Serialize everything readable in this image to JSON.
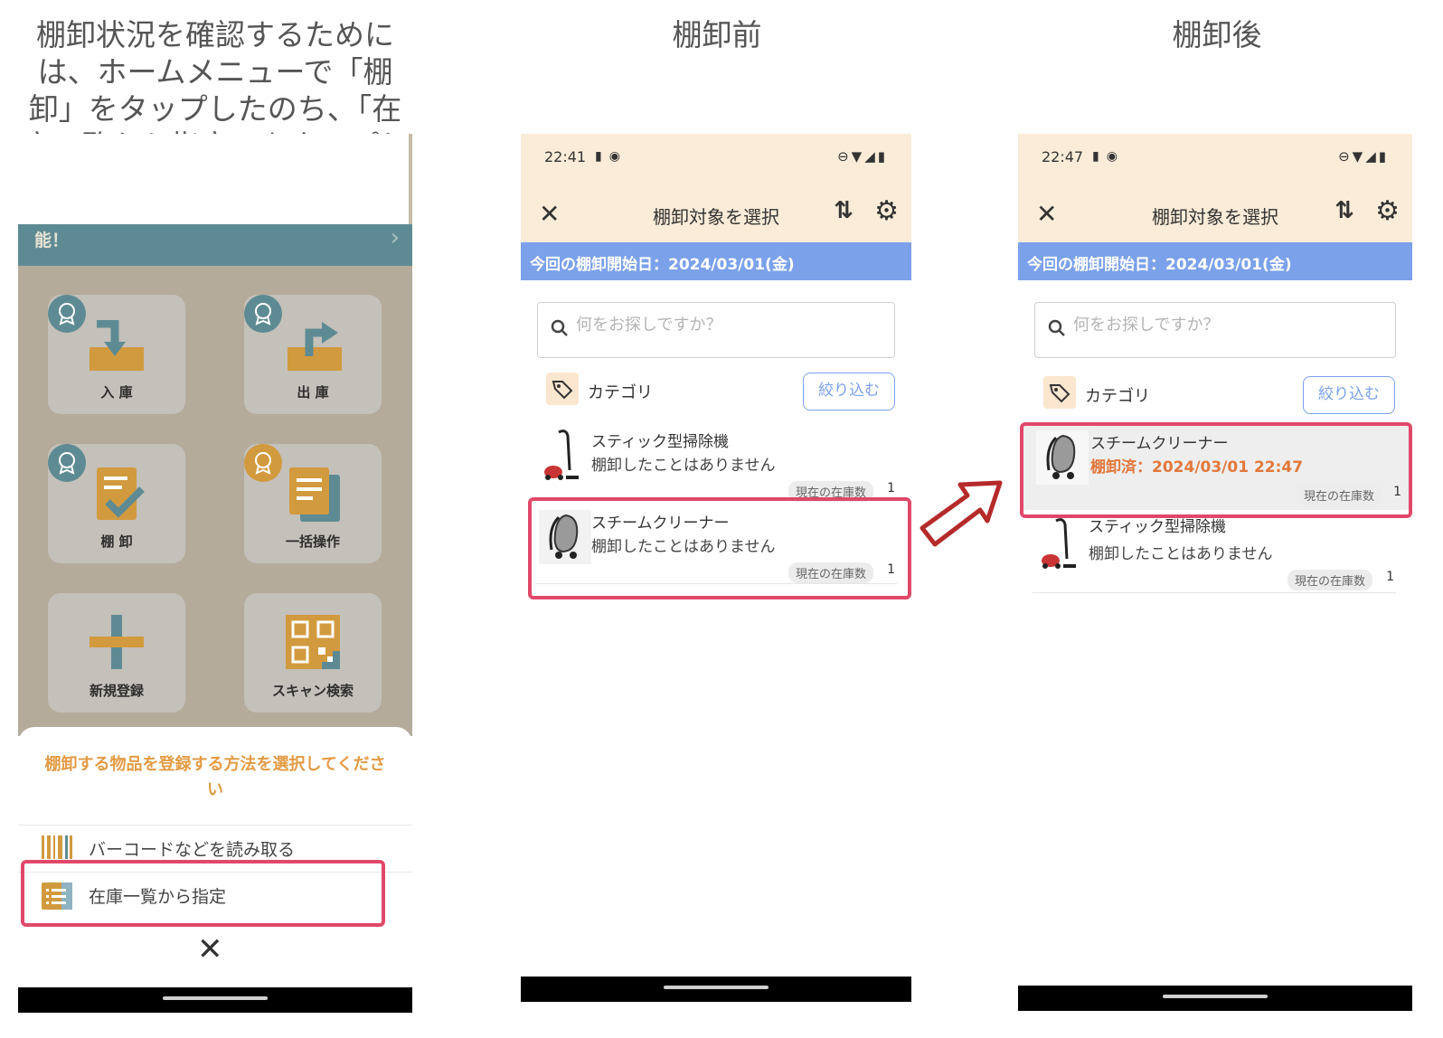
{
  "captions": {
    "left": "棚卸状況を確認するためには、ホームメニューで「棚卸」をタップしたのち、「在庫一覧から指定」をタップします。",
    "middle": "棚卸前",
    "right": "棚卸後"
  },
  "home": {
    "banner_text": "能！",
    "tiles": [
      {
        "label": "入 庫",
        "icon": "inbox-in-icon"
      },
      {
        "label": "出 庫",
        "icon": "inbox-out-icon"
      },
      {
        "label": "棚 卸",
        "icon": "clipboard-check-icon"
      },
      {
        "label": "一括操作",
        "icon": "document-stack-icon"
      },
      {
        "label": "新規登録",
        "icon": "plus-icon"
      },
      {
        "label": "スキャン検索",
        "icon": "qr-code-icon"
      }
    ],
    "sheet": {
      "title": "棚卸する物品を登録する方法を選択してください",
      "option_barcode": "バーコードなどを読み取る",
      "option_list": "在庫一覧から指定",
      "close": "✕"
    }
  },
  "before": {
    "status_time": "22:41",
    "toolbar_title": "棚卸対象を選択",
    "close": "✕",
    "sort": "⇅",
    "gear": "⚙",
    "start_bar": "今回の棚卸開始日：2024/03/01(金)",
    "search_placeholder": "何をお探しですか？",
    "category_label": "カテゴリ",
    "filter_button": "絞り込む",
    "items": [
      {
        "name": "スティック型掃除機",
        "status": "棚卸したことはありません",
        "stock_label": "現在の在庫数",
        "stock": "1"
      },
      {
        "name": "スチームクリーナー",
        "status": "棚卸したことはありません",
        "stock_label": "現在の在庫数",
        "stock": "1"
      }
    ]
  },
  "after": {
    "status_time": "22:47",
    "toolbar_title": "棚卸対象を選択",
    "close": "✕",
    "sort": "⇅",
    "gear": "⚙",
    "start_bar": "今回の棚卸開始日：2024/03/01(金)",
    "search_placeholder": "何をお探しですか？",
    "category_label": "カテゴリ",
    "filter_button": "絞り込む",
    "items": [
      {
        "name": "スチームクリーナー",
        "status": "棚卸済：2024/03/01 22:47",
        "stock_label": "現在の在庫数",
        "stock": "1"
      },
      {
        "name": "スティック型掃除機",
        "status": "棚卸したことはありません",
        "stock_label": "現在の在庫数",
        "stock": "1"
      }
    ]
  },
  "colors": {
    "accent_blue": "#7ba1ea",
    "highlight_red": "#e0486a",
    "done_orange": "#e2783c",
    "header_cream": "#fbecd9",
    "icon_gold": "#d29a3e"
  }
}
